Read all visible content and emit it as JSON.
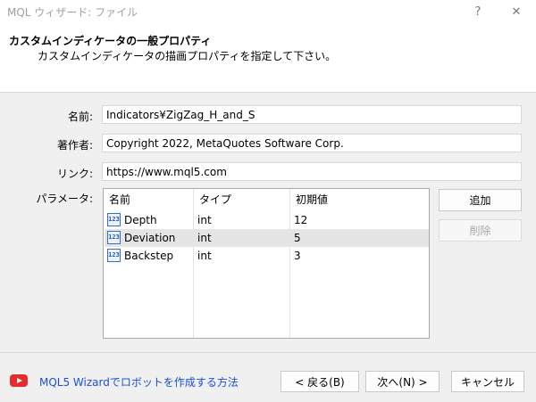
{
  "window": {
    "title": "MQL ウィザード: ファイル",
    "help_glyph": "?",
    "close_glyph": "✕"
  },
  "header": {
    "title": "カスタムインディケータの一般プロパティ",
    "subtitle": "カスタムインディケータの描画プロパティを指定して下さい。"
  },
  "form": {
    "name_label": "名前:",
    "name_value": "Indicators¥ZigZag_H_and_S",
    "author_label": "著作者:",
    "author_value": "Copyright 2022, MetaQuotes Software Corp.",
    "link_label": "リンク:",
    "link_value": "https://www.mql5.com",
    "params_label": "パラメータ:"
  },
  "params_table": {
    "columns": [
      "名前",
      "タイプ",
      "初期値"
    ],
    "rows": [
      {
        "name": "Depth",
        "type": "int",
        "value": "12",
        "icon": "int-param-icon",
        "icon_text": "123"
      },
      {
        "name": "Deviation",
        "type": "int",
        "value": "5",
        "icon": "int-param-icon",
        "icon_text": "123",
        "selected": true
      },
      {
        "name": "Backstep",
        "type": "int",
        "value": "3",
        "icon": "int-param-icon",
        "icon_text": "123"
      }
    ]
  },
  "side_buttons": {
    "add": "追加",
    "delete": "削除"
  },
  "footer": {
    "video_link": "MQL5 Wizardでロボットを作成する方法",
    "back_button": "< 戻る(B)",
    "next_button": "次へ(N) >",
    "cancel_button": "キャンセル"
  },
  "colors": {
    "link": "#1a4fd6",
    "youtube_red": "#e52b2b",
    "selected_row": "#e5e5e5"
  }
}
